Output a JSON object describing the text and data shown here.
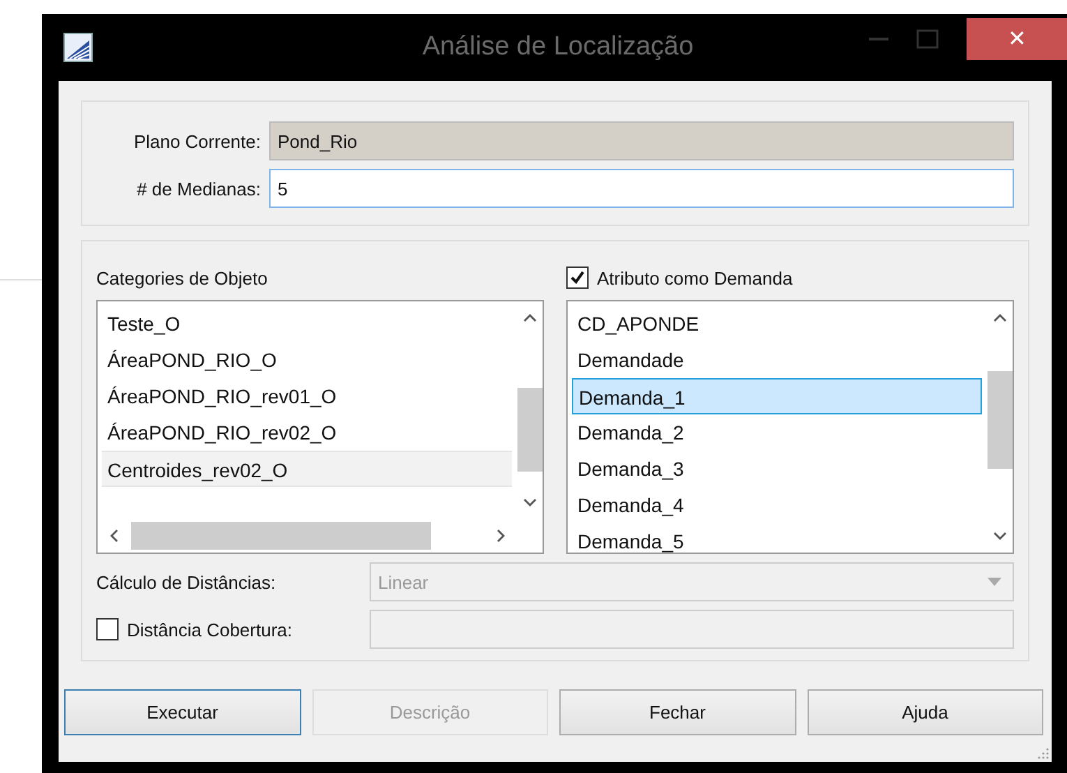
{
  "window": {
    "title": "Análise de Localização",
    "close": "✕"
  },
  "plan": {
    "label": "Plano Corrente:",
    "value": "Pond_Rio",
    "disabled": true
  },
  "medians": {
    "label": "# de Medianas:",
    "value": "5",
    "disabled": false
  },
  "categories": {
    "label": "Categories de Objeto",
    "items": [
      {
        "label": "Teste_O",
        "selected": false
      },
      {
        "label": "ÁreaPOND_RIO_O",
        "selected": false
      },
      {
        "label": "ÁreaPOND_RIO_rev01_O",
        "selected": false
      },
      {
        "label": "ÁreaPOND_RIO_rev02_O",
        "selected": false
      },
      {
        "label": "Centroides_rev02_O",
        "selected": true
      }
    ]
  },
  "attribute": {
    "label": "Atributo como Demanda",
    "checked": true,
    "items": [
      {
        "label": "CD_APONDE",
        "selected": false
      },
      {
        "label": "Demandade",
        "selected": false
      },
      {
        "label": "Demanda_1",
        "selected": true
      },
      {
        "label": "Demanda_2",
        "selected": false
      },
      {
        "label": "Demanda_3",
        "selected": false
      },
      {
        "label": "Demanda_4",
        "selected": false
      },
      {
        "label": "Demanda_5",
        "selected": false
      }
    ]
  },
  "distance": {
    "label": "Cálculo de Distâncias:",
    "value": "Linear",
    "disabled": true
  },
  "coverage": {
    "label": "Distância Cobertura:",
    "checked": false,
    "disabled": true
  },
  "buttons": [
    {
      "label": "Executar",
      "disabled": false,
      "default": true
    },
    {
      "label": "Descrição",
      "disabled": true,
      "default": false
    },
    {
      "label": "Fechar",
      "disabled": false,
      "default": false
    },
    {
      "label": "Ajuda",
      "disabled": false,
      "default": false
    }
  ]
}
